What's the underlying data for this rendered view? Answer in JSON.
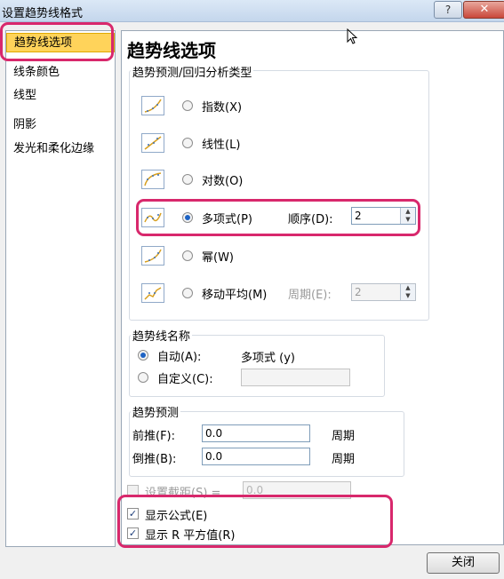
{
  "window": {
    "title": "设置趋势线格式",
    "help_label": "?",
    "close_glyph": "✕"
  },
  "sidebar": {
    "items": [
      {
        "label": "趋势线选项",
        "selected": true
      },
      {
        "label": "线条颜色"
      },
      {
        "label": "线型"
      },
      {
        "label": "阴影"
      },
      {
        "label": "发光和柔化边缘"
      }
    ]
  },
  "panel": {
    "heading": "趋势线选项",
    "type_group": {
      "label": "趋势预测/回归分析类型",
      "options": [
        {
          "label": "指数(X)",
          "selected": false
        },
        {
          "label": "线性(L)",
          "selected": false
        },
        {
          "label": "对数(O)",
          "selected": false
        },
        {
          "label": "多项式(P)",
          "selected": true
        },
        {
          "label": "幂(W)",
          "selected": false
        },
        {
          "label": "移动平均(M)",
          "selected": false
        }
      ],
      "order_label": "顺序(D):",
      "order_value": "2",
      "period_label": "周期(E):",
      "period_value": "2"
    },
    "name_group": {
      "label": "趋势线名称",
      "auto_label": "自动(A):",
      "auto_value": "多项式 (y)",
      "custom_label": "自定义(C):",
      "custom_value": ""
    },
    "forecast_group": {
      "label": "趋势预测",
      "forward_label": "前推(F):",
      "forward_value": "0.0",
      "forward_unit": "周期",
      "backward_label": "倒推(B):",
      "backward_value": "0.0",
      "backward_unit": "周期"
    },
    "intercept_label": "设置截距(S) =",
    "intercept_value": "0.0",
    "show_equation_label": "显示公式(E)",
    "show_r2_label": "显示 R 平方值(R)"
  },
  "footer": {
    "close_label": "关闭"
  },
  "colors": {
    "highlight": "#d8286c",
    "selection": "#ffd35a"
  }
}
